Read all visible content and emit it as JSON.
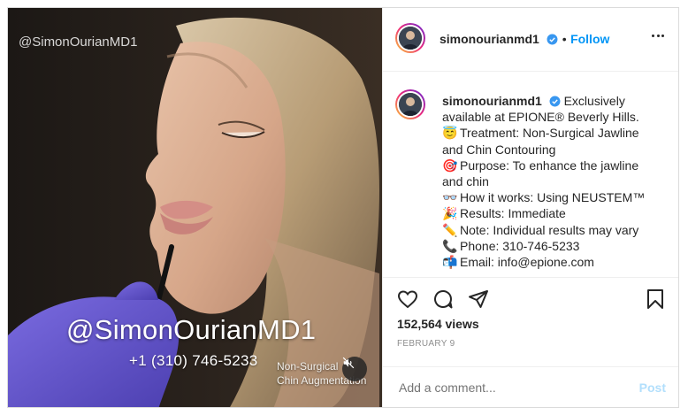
{
  "media": {
    "watermark": "@SimonOurianMD1",
    "overlay_handle": "@SimonOurianMD1",
    "overlay_phone": "+1 (310) 746-5233",
    "overlay_caption_line1": "Non-Surgical",
    "overlay_caption_line2": "Chin Augmentation",
    "mute_icon": "speaker-muted-icon"
  },
  "header": {
    "username": "simonourianmd1",
    "separator": "•",
    "follow_label": "Follow",
    "more_icon": "more-options-icon"
  },
  "caption": {
    "username": "simonourianmd1",
    "line1": "Exclusively available at EPIONE® Beverly Hills.",
    "lines": [
      {
        "emoji": "😇",
        "text": "Treatment: Non-Surgical Jawline and Chin Contouring"
      },
      {
        "emoji": "🎯",
        "text": "Purpose: To enhance the jawline and chin"
      },
      {
        "emoji": "👓",
        "text": "How it works: Using NEUSTEM™"
      },
      {
        "emoji": "🎉",
        "text": "Results: Immediate"
      },
      {
        "emoji": "✏️",
        "text": "Note: Individual results may vary"
      },
      {
        "emoji": "📞",
        "text": "Phone: 310-746-5233"
      },
      {
        "emoji": "📬",
        "text": "Email: info@epione.com"
      }
    ]
  },
  "stats": {
    "views": "152,564 views",
    "date": "FEBRUARY 9"
  },
  "comment": {
    "placeholder": "Add a comment...",
    "post_label": "Post"
  },
  "colors": {
    "accent": "#0095f6",
    "post_disabled": "#b2dffc",
    "verified": "#3897f0"
  }
}
